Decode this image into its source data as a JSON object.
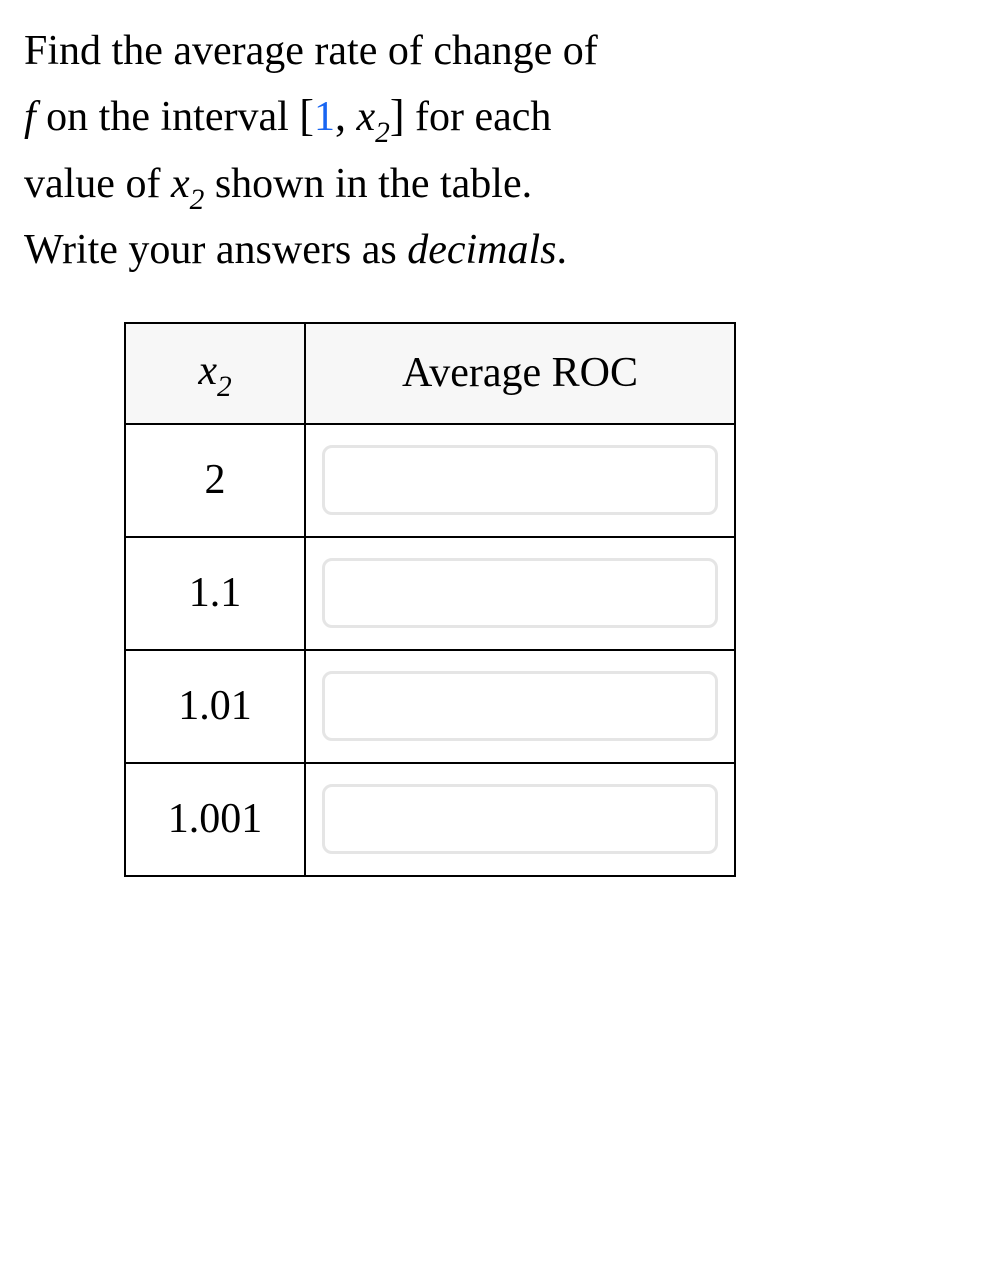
{
  "problem": {
    "line1_pre": "Find the average rate of change of",
    "line2_pre": "on the interval",
    "line2_post": "for each",
    "line3_pre": "value of",
    "line3_post": "shown in the table.",
    "line4": "Write your answers as",
    "line4_emph": "decimals",
    "interval_start": "1"
  },
  "table": {
    "header": {
      "x2_label": "x",
      "x2_sub": "2",
      "roc_label": "Average ROC"
    },
    "rows": [
      {
        "x2": "2",
        "value": ""
      },
      {
        "x2": "1.1",
        "value": ""
      },
      {
        "x2": "1.01",
        "value": ""
      },
      {
        "x2": "1.001",
        "value": ""
      }
    ]
  }
}
